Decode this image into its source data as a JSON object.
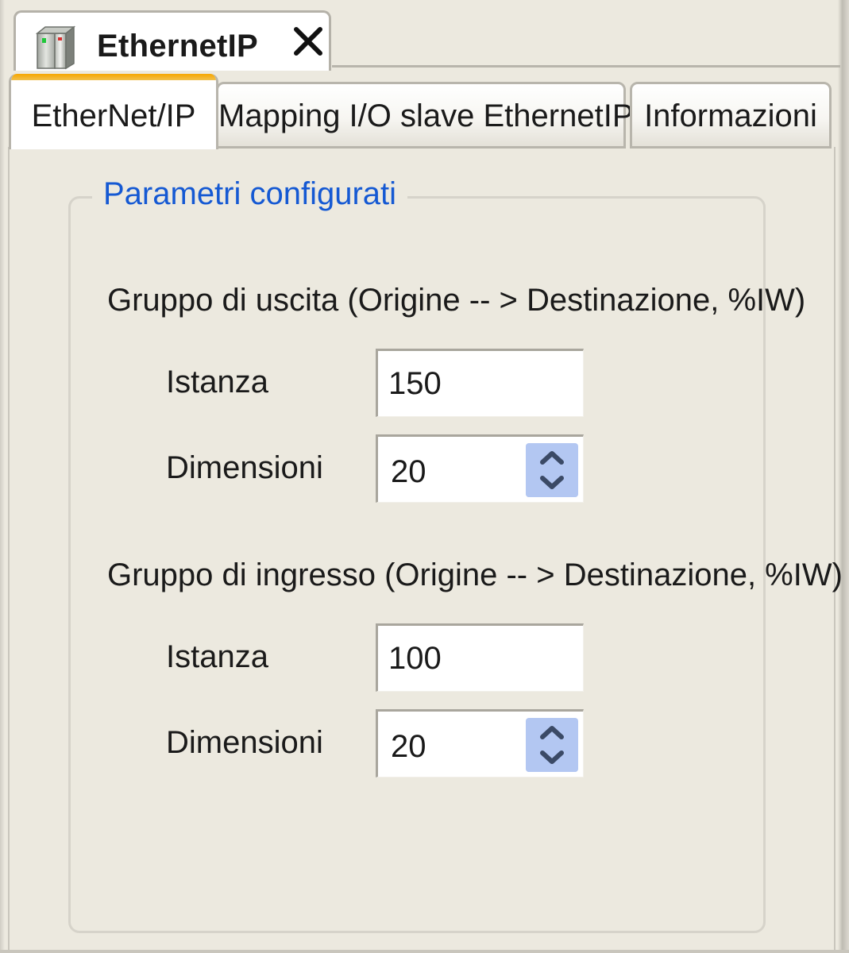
{
  "document_tab": {
    "title": "EthernetIP",
    "icon": "device-module-icon",
    "close_icon": "close-icon"
  },
  "tabs": [
    {
      "label": "EtherNet/IP",
      "active": true
    },
    {
      "label": "Mapping I/O slave EthernetIP",
      "active": false
    },
    {
      "label": "Informazioni",
      "active": false
    }
  ],
  "colors": {
    "active_tab_accent": "#f7a600",
    "group_title": "#1559d3",
    "background": "#ece9df",
    "spinner": "#b3c7f2"
  },
  "groupbox": {
    "title": "Parametri configurati",
    "output_group": {
      "heading": "Gruppo di uscita (Origine -- > Destinazione, %IW)",
      "instance_label": "Istanza",
      "instance_value": "150",
      "size_label": "Dimensioni",
      "size_value": "20"
    },
    "input_group": {
      "heading": "Gruppo di ingresso (Origine -- > Destinazione, %IW)",
      "instance_label": "Istanza",
      "instance_value": "100",
      "size_label": "Dimensioni",
      "size_value": "20"
    }
  }
}
